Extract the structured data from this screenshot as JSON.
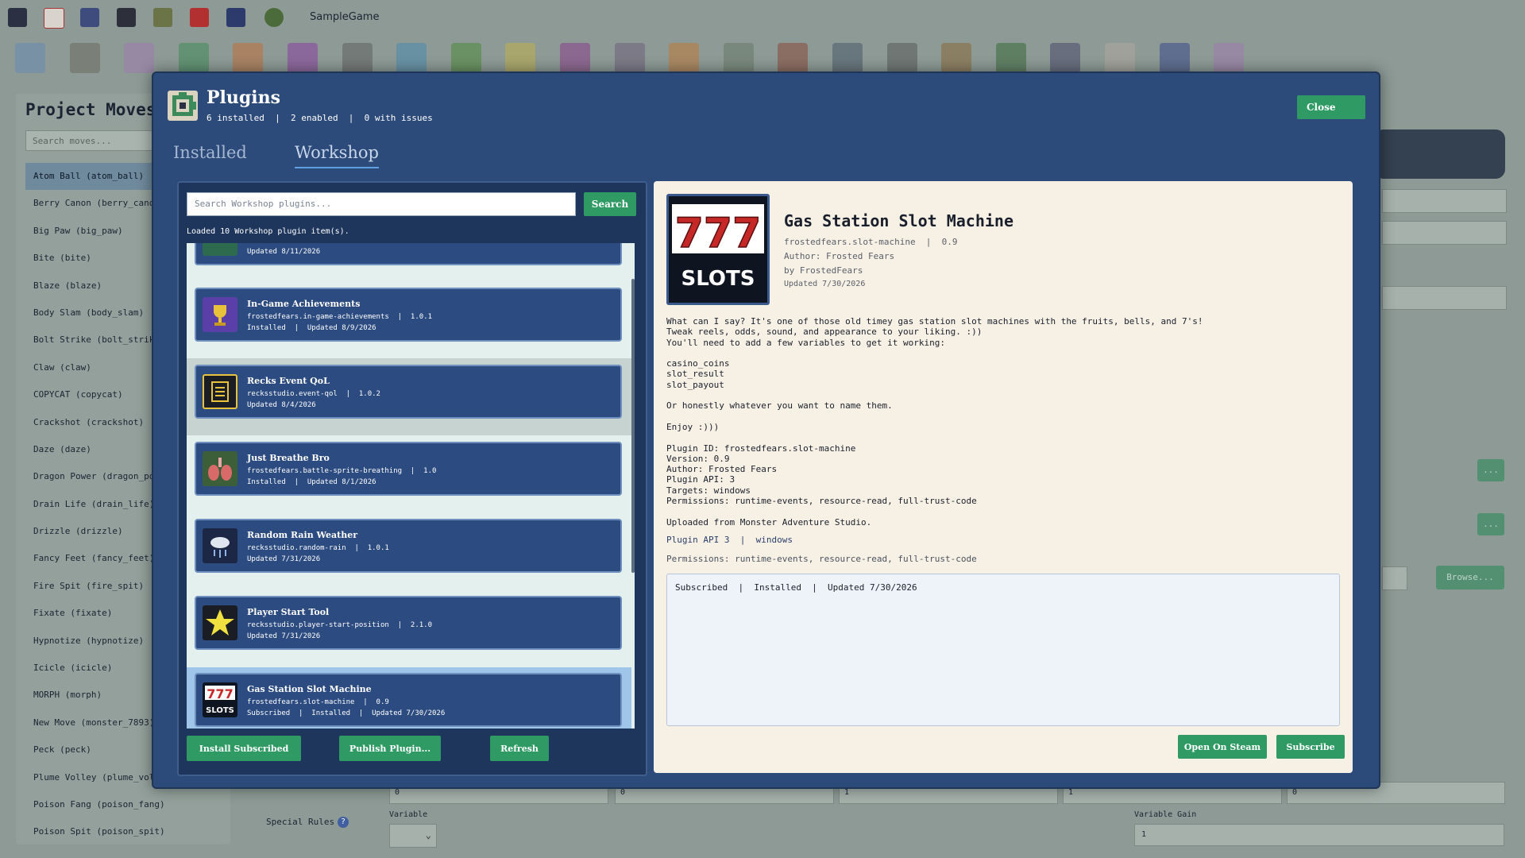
{
  "app": {
    "title": "SampleGame",
    "toolbar_icons": [
      "save-icon",
      "exit-icon",
      "map-edit-icon",
      "database-icon",
      "tileset-icon",
      "stop-icon",
      "sprite-icon",
      "dragon-icon"
    ],
    "editor_icons": [
      "map-icon",
      "monster-icon",
      "item-icon",
      "play-icon",
      "versus-icon",
      "fire-icon",
      "runner-icon",
      "target-icon",
      "apple-icon",
      "potion-icon",
      "creature-icon",
      "characters-icon",
      "tools-icon",
      "landscape-icon",
      "building-icon",
      "script-icon",
      "music-icon",
      "portrait-icon",
      "variables-icon",
      "list-icon",
      "paper-icon",
      "grid-icon",
      "plugin-icon"
    ],
    "left_panel": {
      "title": "Project Moves",
      "search_placeholder": "Search moves...",
      "items": [
        "Atom Ball (atom_ball)",
        "Berry Canon (berry_canon)",
        "Big Paw (big_paw)",
        "Bite (bite)",
        "Blaze (blaze)",
        "Body Slam (body_slam)",
        "Bolt Strike (bolt_strike)",
        "Claw (claw)",
        "COPYCAT (copycat)",
        "Crackshot (crackshot)",
        "Daze (daze)",
        "Dragon Power (dragon_power)",
        "Drain Life (drain_life)",
        "Drizzle (drizzle)",
        "Fancy Feet (fancy_feet)",
        "Fire Spit (fire_spit)",
        "Fixate (fixate)",
        "Hypnotize (hypnotize)",
        "Icicle (icicle)",
        "MORPH (morph)",
        "New Move (monster_7893)",
        "Peck (peck)",
        "Plume Volley (plume_volley)",
        "Poison Fang (poison_fang)",
        "Poison Spit (poison_spit)"
      ],
      "selected_index": 0
    },
    "bg_form": {
      "special_rules_label": "Special Rules",
      "variable_label": "Variable",
      "variable_gain_label": "Variable Gain",
      "variable_gain_value": "1",
      "browse_label": "Browse...",
      "zero": "0",
      "one": "1",
      "add_mark": "..."
    }
  },
  "modal": {
    "title": "Plugins",
    "subtitle": "6 installed  |  2 enabled  |  0 with issues",
    "close_label": "Close",
    "tabs": [
      {
        "label": "Installed",
        "active": false
      },
      {
        "label": "Workshop",
        "active": true
      }
    ],
    "workshop": {
      "search_placeholder": "Search Workshop plugins...",
      "search_button": "Search",
      "status": "Loaded 10 Workshop plugin item(s).",
      "partial_item_updated": "Updated 8/11/2026",
      "items": [
        {
          "name": "In-Game Achievements",
          "id_version": "frostedfears.in-game-achievements  |  1.0.1",
          "status": "Installed  |  Updated 8/9/2026",
          "icon": "trophy-icon",
          "icon_bg": "#5a3fa8"
        },
        {
          "name": "Recks Event QoL",
          "id_version": "recksstudio.event-qol  |  1.0.2",
          "status": "Updated 8/4/2026",
          "icon": "checklist-icon",
          "icon_bg": "#1b1d24"
        },
        {
          "name": "Just Breathe Bro",
          "id_version": "frostedfears.battle-sprite-breathing  |  1.0",
          "status": "Installed  |  Updated 8/1/2026",
          "icon": "lungs-icon",
          "icon_bg": "#3c5f3a"
        },
        {
          "name": "Random Rain Weather",
          "id_version": "recksstudio.random-rain  |  1.0.1",
          "status": "Updated 7/31/2026",
          "icon": "rain-cloud-icon",
          "icon_bg": "#1b2744"
        },
        {
          "name": "Player Start Tool",
          "id_version": "recksstudio.player-start-position  |  2.1.0",
          "status": "Updated 7/31/2026",
          "icon": "start-star-icon",
          "icon_bg": "#1b1d24"
        },
        {
          "name": "Gas Station Slot Machine",
          "id_version": "frostedfears.slot-machine  |  0.9",
          "status": "Subscribed  |  Installed  |  Updated 7/30/2026",
          "icon": "slots-icon",
          "icon_bg": "#0e1420"
        }
      ],
      "buttons": {
        "install_subscribed": "Install Subscribed",
        "publish": "Publish Plugin...",
        "refresh": "Refresh"
      }
    },
    "detail": {
      "art_top": "777",
      "art_bottom": "SLOTS",
      "title": "Gas Station Slot Machine",
      "id_version": "frostedfears.slot-machine  |  0.9",
      "author": "Author: Frosted Fears",
      "by": "by FrostedFears",
      "updated": "Updated 7/30/2026",
      "description": "What can I say? It's one of those old timey gas station slot machines with the fruits, bells, and 7's!\nTweak reels, odds, sound, and appearance to your liking. :))\nYou'll need to add a few variables to get it working:\n\ncasino_coins\nslot_result\nslot_payout\n\nOr honestly whatever you want to name them.\n\nEnjoy :)))\n\nPlugin ID: frostedfears.slot-machine\nVersion: 0.9\nAuthor: Frosted Fears\nPlugin API: 3\nTargets: windows\nPermissions: runtime-events, resource-read, full-trust-code\n\nUploaded from Monster Adventure Studio.",
      "api_targets": "Plugin API 3  |  windows",
      "permissions": "Permissions: runtime-events, resource-read, full-trust-code",
      "status_box": "Subscribed  |  Installed  |  Updated 7/30/2026",
      "open_steam": "Open On Steam",
      "subscribe": "Subscribe"
    }
  },
  "colors": {
    "modal_bg": "#2c4a7a",
    "accent_green": "#2f9a64",
    "detail_bg": "#f7f1e5",
    "card_bg": "#2c4b80"
  }
}
